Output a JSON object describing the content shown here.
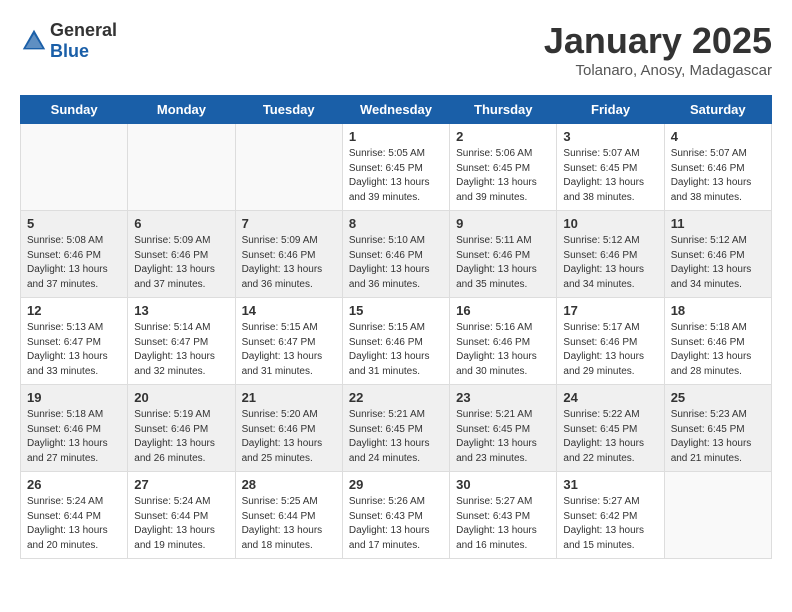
{
  "header": {
    "logo_general": "General",
    "logo_blue": "Blue",
    "month_title": "January 2025",
    "location": "Tolanaro, Anosy, Madagascar"
  },
  "weekdays": [
    "Sunday",
    "Monday",
    "Tuesday",
    "Wednesday",
    "Thursday",
    "Friday",
    "Saturday"
  ],
  "weeks": [
    [
      {
        "day": "",
        "info": ""
      },
      {
        "day": "",
        "info": ""
      },
      {
        "day": "",
        "info": ""
      },
      {
        "day": "1",
        "info": "Sunrise: 5:05 AM\nSunset: 6:45 PM\nDaylight: 13 hours\nand 39 minutes."
      },
      {
        "day": "2",
        "info": "Sunrise: 5:06 AM\nSunset: 6:45 PM\nDaylight: 13 hours\nand 39 minutes."
      },
      {
        "day": "3",
        "info": "Sunrise: 5:07 AM\nSunset: 6:45 PM\nDaylight: 13 hours\nand 38 minutes."
      },
      {
        "day": "4",
        "info": "Sunrise: 5:07 AM\nSunset: 6:46 PM\nDaylight: 13 hours\nand 38 minutes."
      }
    ],
    [
      {
        "day": "5",
        "info": "Sunrise: 5:08 AM\nSunset: 6:46 PM\nDaylight: 13 hours\nand 37 minutes."
      },
      {
        "day": "6",
        "info": "Sunrise: 5:09 AM\nSunset: 6:46 PM\nDaylight: 13 hours\nand 37 minutes."
      },
      {
        "day": "7",
        "info": "Sunrise: 5:09 AM\nSunset: 6:46 PM\nDaylight: 13 hours\nand 36 minutes."
      },
      {
        "day": "8",
        "info": "Sunrise: 5:10 AM\nSunset: 6:46 PM\nDaylight: 13 hours\nand 36 minutes."
      },
      {
        "day": "9",
        "info": "Sunrise: 5:11 AM\nSunset: 6:46 PM\nDaylight: 13 hours\nand 35 minutes."
      },
      {
        "day": "10",
        "info": "Sunrise: 5:12 AM\nSunset: 6:46 PM\nDaylight: 13 hours\nand 34 minutes."
      },
      {
        "day": "11",
        "info": "Sunrise: 5:12 AM\nSunset: 6:46 PM\nDaylight: 13 hours\nand 34 minutes."
      }
    ],
    [
      {
        "day": "12",
        "info": "Sunrise: 5:13 AM\nSunset: 6:47 PM\nDaylight: 13 hours\nand 33 minutes."
      },
      {
        "day": "13",
        "info": "Sunrise: 5:14 AM\nSunset: 6:47 PM\nDaylight: 13 hours\nand 32 minutes."
      },
      {
        "day": "14",
        "info": "Sunrise: 5:15 AM\nSunset: 6:47 PM\nDaylight: 13 hours\nand 31 minutes."
      },
      {
        "day": "15",
        "info": "Sunrise: 5:15 AM\nSunset: 6:46 PM\nDaylight: 13 hours\nand 31 minutes."
      },
      {
        "day": "16",
        "info": "Sunrise: 5:16 AM\nSunset: 6:46 PM\nDaylight: 13 hours\nand 30 minutes."
      },
      {
        "day": "17",
        "info": "Sunrise: 5:17 AM\nSunset: 6:46 PM\nDaylight: 13 hours\nand 29 minutes."
      },
      {
        "day": "18",
        "info": "Sunrise: 5:18 AM\nSunset: 6:46 PM\nDaylight: 13 hours\nand 28 minutes."
      }
    ],
    [
      {
        "day": "19",
        "info": "Sunrise: 5:18 AM\nSunset: 6:46 PM\nDaylight: 13 hours\nand 27 minutes."
      },
      {
        "day": "20",
        "info": "Sunrise: 5:19 AM\nSunset: 6:46 PM\nDaylight: 13 hours\nand 26 minutes."
      },
      {
        "day": "21",
        "info": "Sunrise: 5:20 AM\nSunset: 6:46 PM\nDaylight: 13 hours\nand 25 minutes."
      },
      {
        "day": "22",
        "info": "Sunrise: 5:21 AM\nSunset: 6:45 PM\nDaylight: 13 hours\nand 24 minutes."
      },
      {
        "day": "23",
        "info": "Sunrise: 5:21 AM\nSunset: 6:45 PM\nDaylight: 13 hours\nand 23 minutes."
      },
      {
        "day": "24",
        "info": "Sunrise: 5:22 AM\nSunset: 6:45 PM\nDaylight: 13 hours\nand 22 minutes."
      },
      {
        "day": "25",
        "info": "Sunrise: 5:23 AM\nSunset: 6:45 PM\nDaylight: 13 hours\nand 21 minutes."
      }
    ],
    [
      {
        "day": "26",
        "info": "Sunrise: 5:24 AM\nSunset: 6:44 PM\nDaylight: 13 hours\nand 20 minutes."
      },
      {
        "day": "27",
        "info": "Sunrise: 5:24 AM\nSunset: 6:44 PM\nDaylight: 13 hours\nand 19 minutes."
      },
      {
        "day": "28",
        "info": "Sunrise: 5:25 AM\nSunset: 6:44 PM\nDaylight: 13 hours\nand 18 minutes."
      },
      {
        "day": "29",
        "info": "Sunrise: 5:26 AM\nSunset: 6:43 PM\nDaylight: 13 hours\nand 17 minutes."
      },
      {
        "day": "30",
        "info": "Sunrise: 5:27 AM\nSunset: 6:43 PM\nDaylight: 13 hours\nand 16 minutes."
      },
      {
        "day": "31",
        "info": "Sunrise: 5:27 AM\nSunset: 6:42 PM\nDaylight: 13 hours\nand 15 minutes."
      },
      {
        "day": "",
        "info": ""
      }
    ]
  ]
}
